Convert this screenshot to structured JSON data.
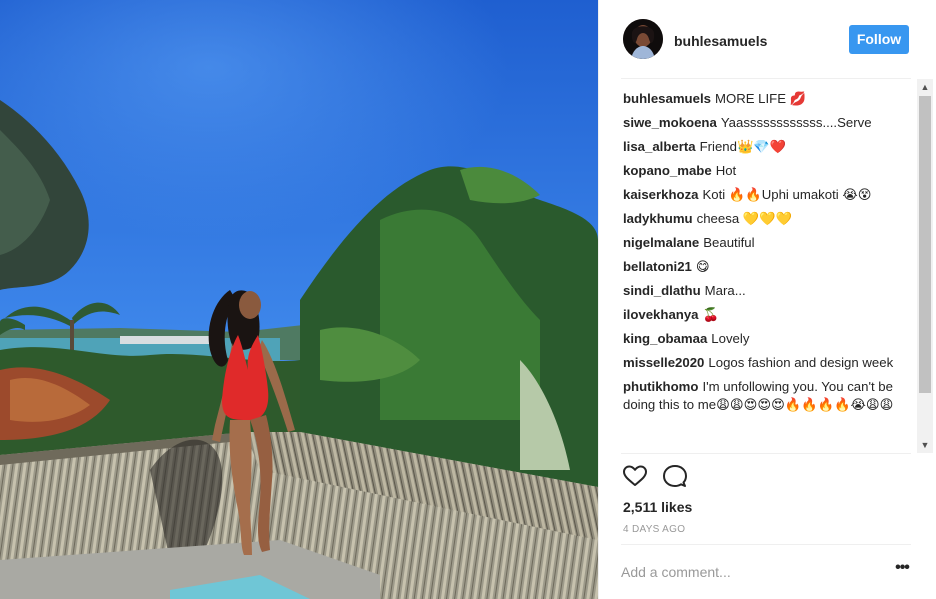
{
  "header": {
    "username": "buhlesamuels",
    "follow_label": "Follow"
  },
  "comments": [
    {
      "user": "buhlesamuels",
      "text": "MORE LIFE 💋"
    },
    {
      "user": "siwe_mokoena",
      "text": "Yaassssssssssss....Serve"
    },
    {
      "user": "lisa_alberta",
      "text": "Friend👑💎❤️"
    },
    {
      "user": "kopano_mabe",
      "text": "Hot"
    },
    {
      "user": "kaiserkhoza",
      "text": "Koti 🔥🔥Uphi umakoti 😭😵"
    },
    {
      "user": "ladykhumu",
      "text": "cheesa 💛💛💛"
    },
    {
      "user": "nigelmalane",
      "text": "Beautiful"
    },
    {
      "user": "bellatoni21",
      "text": "😋"
    },
    {
      "user": "sindi_dlathu",
      "text": "Mara..."
    },
    {
      "user": "ilovekhanya",
      "text": "🍒"
    },
    {
      "user": "king_obamaa",
      "text": "Lovely"
    },
    {
      "user": "misselle2020",
      "text": "Logos fashion and design week"
    },
    {
      "user": "phutikhomo",
      "text": "I'm unfollowing you. You can't be doing this to me😩😩😍😍😍🔥🔥🔥🔥😭😩😩"
    }
  ],
  "actions": {
    "like_icon": "heart-icon",
    "comment_icon": "comment-icon"
  },
  "likes": "2,511 likes",
  "timestamp": "4 DAYS AGO",
  "add_comment": {
    "placeholder": "Add a comment..."
  },
  "more_label": "•••",
  "colors": {
    "follow_button": "#3897f0",
    "sky": "#2f6fd6",
    "swimsuit": "#e02a2a"
  }
}
